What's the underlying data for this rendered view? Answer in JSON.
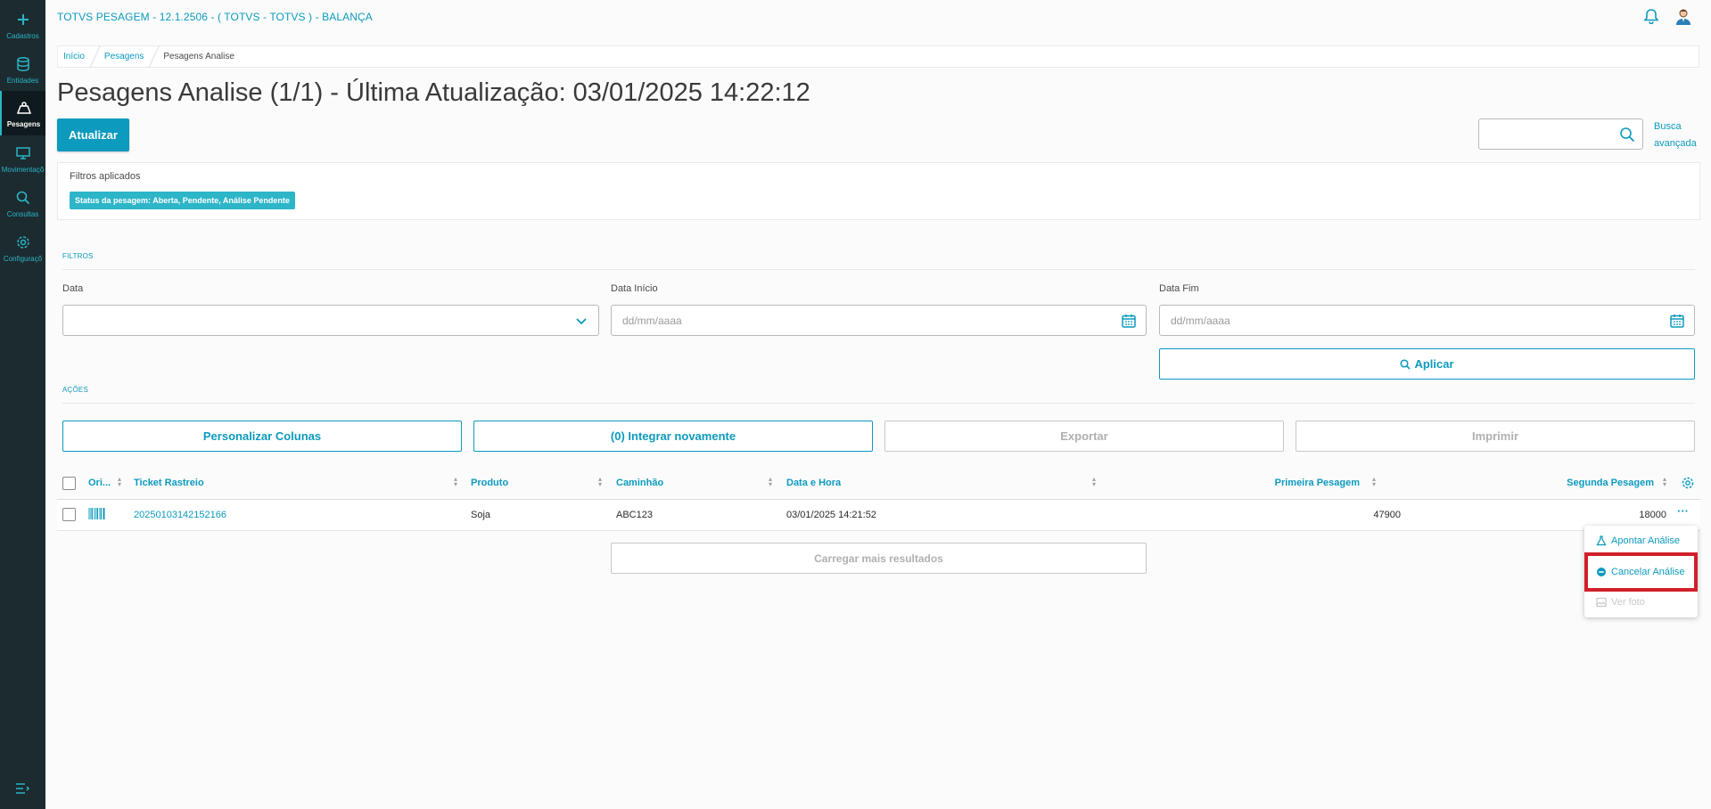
{
  "app": {
    "title": "TOTVS PESAGEM - 12.1.2506 - ( TOTVS - TOTVS ) - BALANÇA"
  },
  "colors": {
    "accent": "#0c9abe",
    "sidebar_bg": "#1c2b30",
    "tag_bg": "#2db5c8",
    "highlight": "#d0202a"
  },
  "sidebar": {
    "items": [
      {
        "label": "Cadastros",
        "icon": "plus-icon"
      },
      {
        "label": "Entidades",
        "icon": "database-icon"
      },
      {
        "label": "Pesagens",
        "icon": "weight-icon",
        "active": true
      },
      {
        "label": "Movimentaçõ",
        "icon": "monitor-icon"
      },
      {
        "label": "Consultas",
        "icon": "search-icon"
      },
      {
        "label": "Configuraçõ",
        "icon": "gear-icon"
      }
    ]
  },
  "breadcrumb": [
    "Início",
    "Pesagens",
    "Pesagens Analise"
  ],
  "page": {
    "title": "Pesagens Analise (1/1) - Última Atualização: 03/01/2025 14:22:12",
    "refresh_label": "Atualizar",
    "advanced_search": "Busca avançada",
    "search_placeholder": ""
  },
  "filters_applied": {
    "title": "Filtros aplicados",
    "tag": "Status da pesagem: Aberta, Pendente, Análise Pendente"
  },
  "filters": {
    "section": "FILTROS",
    "data_label": "Data",
    "data_value": "",
    "start_label": "Data Início",
    "start_placeholder": "dd/mm/aaaa",
    "end_label": "Data Fim",
    "end_placeholder": "dd/mm/aaaa",
    "apply_label": "Aplicar"
  },
  "actions": {
    "section": "AÇÕES",
    "customize": "Personalizar Colunas",
    "integrate": "(0) Integrar novamente",
    "export": "Exportar",
    "print": "Imprimir"
  },
  "table": {
    "columns": [
      "Ori...",
      "Ticket Rastreio",
      "Produto",
      "Caminhão",
      "Data e Hora",
      "Primeira Pesagem",
      "Segunda Pesagem"
    ],
    "rows": [
      {
        "origin_icon": "barcode-icon",
        "ticket": "20250103142152166",
        "produto": "Soja",
        "caminhao": "ABC123",
        "data_hora": "03/01/2025 14:21:52",
        "primeira": "47900",
        "segunda": "18000"
      }
    ],
    "load_more": "Carregar mais resultados"
  },
  "row_menu": {
    "items": [
      {
        "label": "Apontar Análise",
        "icon": "flask-icon",
        "enabled": true
      },
      {
        "label": "Cancelar Análise",
        "icon": "minus-circle-icon",
        "enabled": true
      },
      {
        "label": "Ver foto",
        "icon": "image-icon",
        "enabled": false
      }
    ]
  }
}
